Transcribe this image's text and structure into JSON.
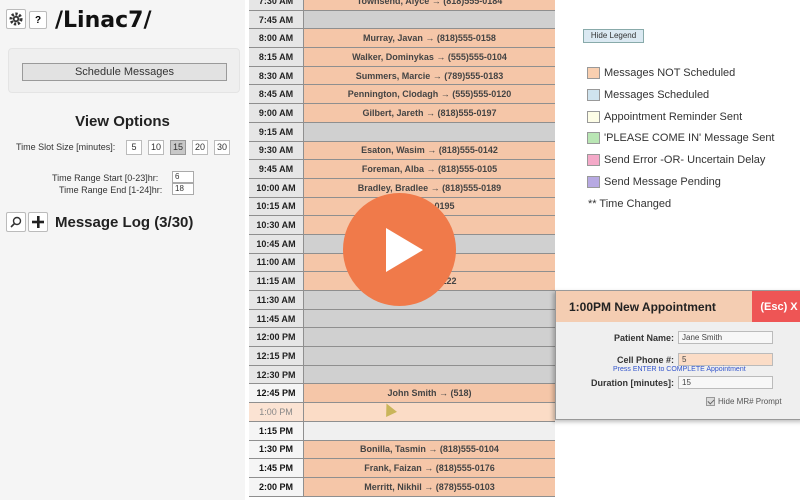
{
  "app": {
    "title": "/Linac7/"
  },
  "left_panel": {
    "help_label": "?",
    "schedule_button": "Schedule Messages",
    "view_options_title": "View Options",
    "time_slot_label": "Time Slot Size [minutes]:",
    "time_slot_options": [
      "5",
      "10",
      "15",
      "20",
      "30"
    ],
    "time_slot_selected": "15",
    "range_start_label": "Time Range Start [0-23]hr:",
    "range_start_value": "6",
    "range_end_label": "Time Range End [1-24]hr:",
    "range_end_value": "18",
    "message_log_title": "Message Log (3/30)"
  },
  "schedule": {
    "rows": [
      {
        "time": "7:30 AM",
        "text": "Townsend, Alyce → (818)555-0184",
        "status": "ns"
      },
      {
        "time": "7:45 AM",
        "text": "",
        "status": "empty"
      },
      {
        "time": "8:00 AM",
        "text": "Murray, Javan → (818)555-0158",
        "status": "ns"
      },
      {
        "time": "8:15 AM",
        "text": "Walker, Dominykas → (555)555-0104",
        "status": "ns"
      },
      {
        "time": "8:30 AM",
        "text": "Summers, Marcie → (789)555-0183",
        "status": "ns"
      },
      {
        "time": "8:45 AM",
        "text": "Pennington, Clodagh → (555)555-0120",
        "status": "ns"
      },
      {
        "time": "9:00 AM",
        "text": "Gilbert, Jareth → (818)555-0197",
        "status": "ns"
      },
      {
        "time": "9:15 AM",
        "text": "",
        "status": "empty"
      },
      {
        "time": "9:30 AM",
        "text": "Esaton, Wasim → (818)555-0142",
        "status": "ns"
      },
      {
        "time": "9:45 AM",
        "text": "Foreman, Alba → (818)555-0105",
        "status": "ns"
      },
      {
        "time": "10:00 AM",
        "text": "Bradley, Bradlee → (818)555-0189",
        "status": "ns"
      },
      {
        "time": "10:15 AM",
        "text": "B                    )555-0195",
        "status": "ns"
      },
      {
        "time": "10:30 AM",
        "text": "                          555-0164",
        "status": "ns"
      },
      {
        "time": "10:45 AM",
        "text": "",
        "status": "empty"
      },
      {
        "time": "11:00 AM",
        "text": "                          )555-0136",
        "status": "ns"
      },
      {
        "time": "11:15 AM",
        "text": "                         )16)555-0122",
        "status": "ns"
      },
      {
        "time": "11:30 AM",
        "text": "",
        "status": "empty"
      },
      {
        "time": "11:45 AM",
        "text": "",
        "status": "empty"
      },
      {
        "time": "12:00 PM",
        "text": "",
        "status": "empty"
      },
      {
        "time": "12:15 PM",
        "text": "",
        "status": "empty"
      },
      {
        "time": "12:30 PM",
        "text": "",
        "status": "empty"
      },
      {
        "time": "12:45 PM",
        "text": "John Smith → (518)",
        "status": "ns",
        "bold_time": true
      },
      {
        "time": "1:00 PM",
        "text": "",
        "status": "new"
      },
      {
        "time": "1:15 PM",
        "text": "",
        "status": "light",
        "bold_time": true
      },
      {
        "time": "1:30 PM",
        "text": "Bonilla, Tasmin → (818)555-0104",
        "status": "ns",
        "bold_time": true
      },
      {
        "time": "1:45 PM",
        "text": "Frank, Faizan → (818)555-0176",
        "status": "ns",
        "bold_time": true
      },
      {
        "time": "2:00 PM",
        "text": "Merritt, Nikhil → (878)555-0103",
        "status": "ns",
        "bold_time": true
      }
    ]
  },
  "legend": {
    "hide_button": "Hide Legend",
    "items": [
      {
        "label": "Messages NOT Scheduled",
        "color": "#f9cfb0"
      },
      {
        "label": "Messages Scheduled",
        "color": "#cfe3ee"
      },
      {
        "label": "Appointment Reminder Sent",
        "color": "#fdfde6"
      },
      {
        "label": "'PLEASE COME IN' Message Sent",
        "color": "#b9e6b4"
      },
      {
        "label": "Send Error -OR- Uncertain Delay",
        "color": "#f4a9c8"
      },
      {
        "label": "Send Message Pending",
        "color": "#b7a9e2"
      }
    ],
    "note": "**   Time Changed"
  },
  "dialog": {
    "title": "1:00PM  New Appointment",
    "esc_label": "(Esc) X",
    "patient_label": "Patient Name:",
    "patient_value": "Jane Smith",
    "phone_label": "Cell Phone #:",
    "phone_value": "5",
    "hint": "Press ENTER to COMPLETE Appointment",
    "duration_label": "Duration [minutes]:",
    "duration_value": "15",
    "checkbox_label": "Hide MR# Prompt"
  }
}
